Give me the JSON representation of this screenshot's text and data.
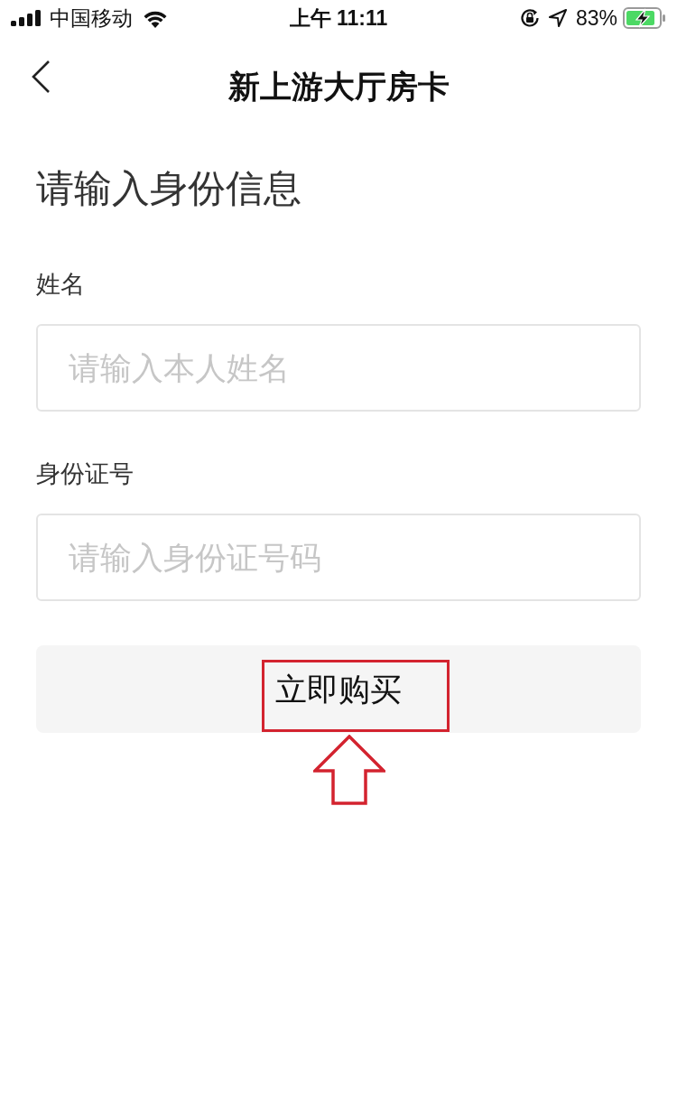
{
  "status_bar": {
    "carrier": "中国移动",
    "time": "上午 11:11",
    "battery": "83%"
  },
  "nav_bar": {
    "title": "新上游大厅房卡"
  },
  "form": {
    "heading": "请输入身份信息",
    "fields": [
      {
        "label": "姓名",
        "placeholder": "请输入本人姓名"
      },
      {
        "label": "身份证号",
        "placeholder": "请输入身份证号码"
      }
    ],
    "submit_button": "立即购买"
  }
}
